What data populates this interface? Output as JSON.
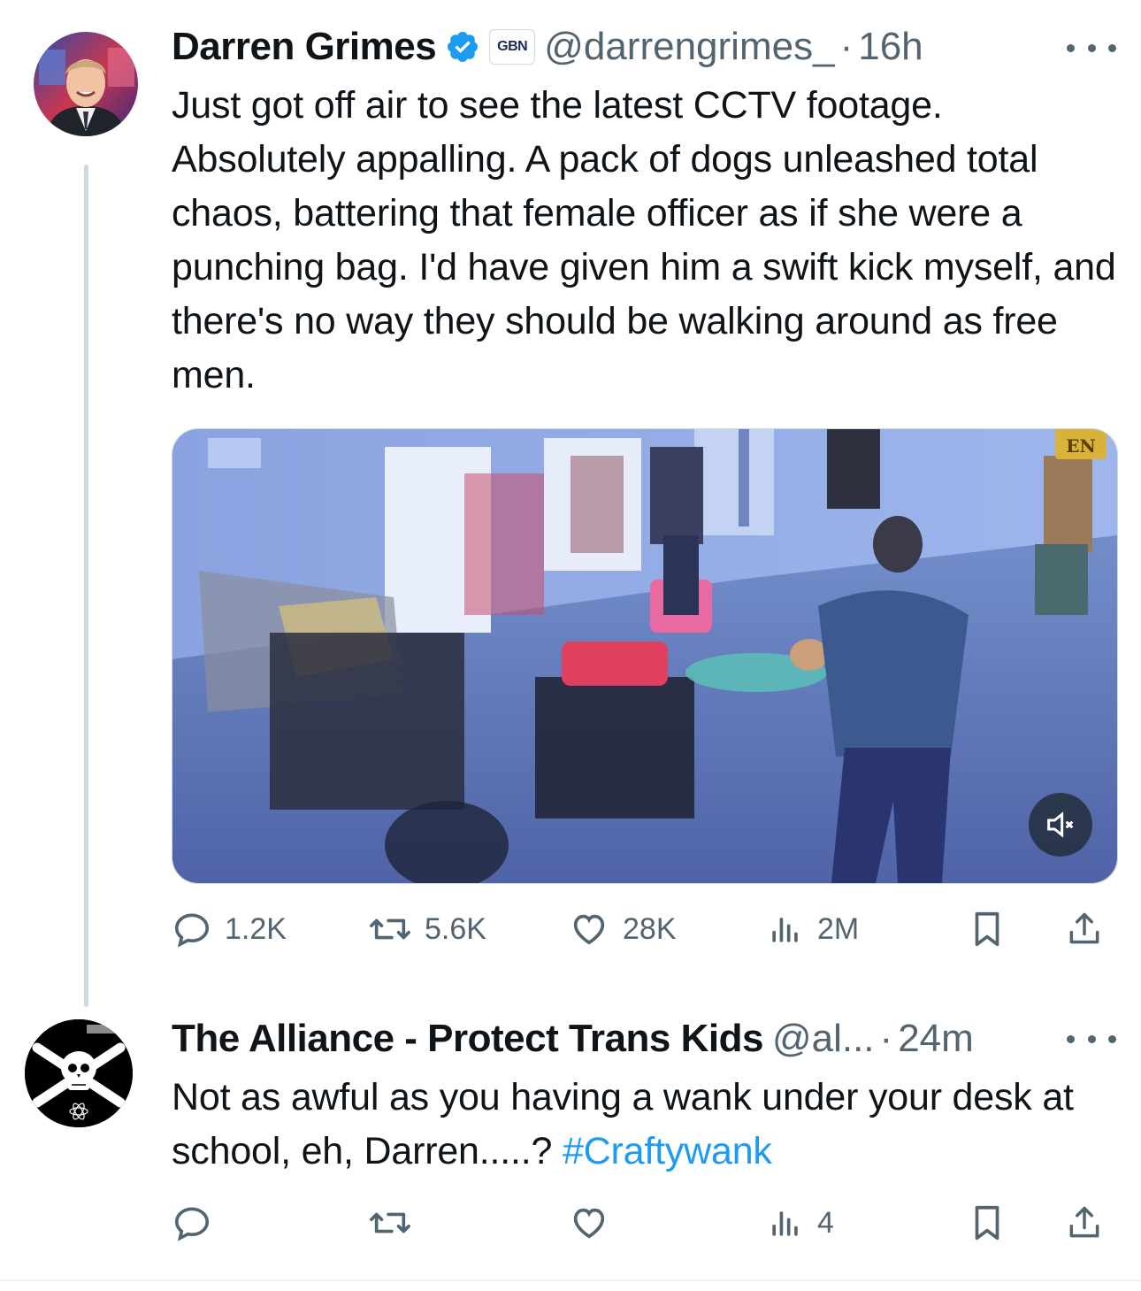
{
  "tweet1": {
    "display_name": "Darren Grimes",
    "affiliate_badge": "GBN",
    "handle": "@darrengrimes_",
    "separator": "·",
    "time": "16h",
    "text": "Just got off air to see the latest CCTV footage. Absolutely appalling. A pack of dogs unleashed total chaos, battering that female officer as if she were a punching bag. I'd have given him a swift kick myself, and there's no way they should be walking around as free men.",
    "media_badge": "EN",
    "actions": {
      "replies": "1.2K",
      "reposts": "5.6K",
      "likes": "28K",
      "views": "2M"
    }
  },
  "tweet2": {
    "display_name": "The Alliance - Protect Trans Kids",
    "handle": "@al...",
    "separator": "·",
    "time": "24m",
    "text": "Not as awful as you having a wank under your desk at school, eh, Darren.....? ",
    "hashtag": "#Craftywank",
    "actions": {
      "views": "4"
    }
  },
  "colors": {
    "text_primary": "#0f1419",
    "text_secondary": "#536471",
    "link": "#1d9bf0",
    "verified": "#1d9bf0",
    "thread_line": "#cfd9de"
  },
  "icons": [
    "verified-badge-icon",
    "more-icon",
    "reply-icon",
    "repost-icon",
    "like-icon",
    "views-icon",
    "bookmark-icon",
    "share-icon",
    "mute-icon"
  ]
}
